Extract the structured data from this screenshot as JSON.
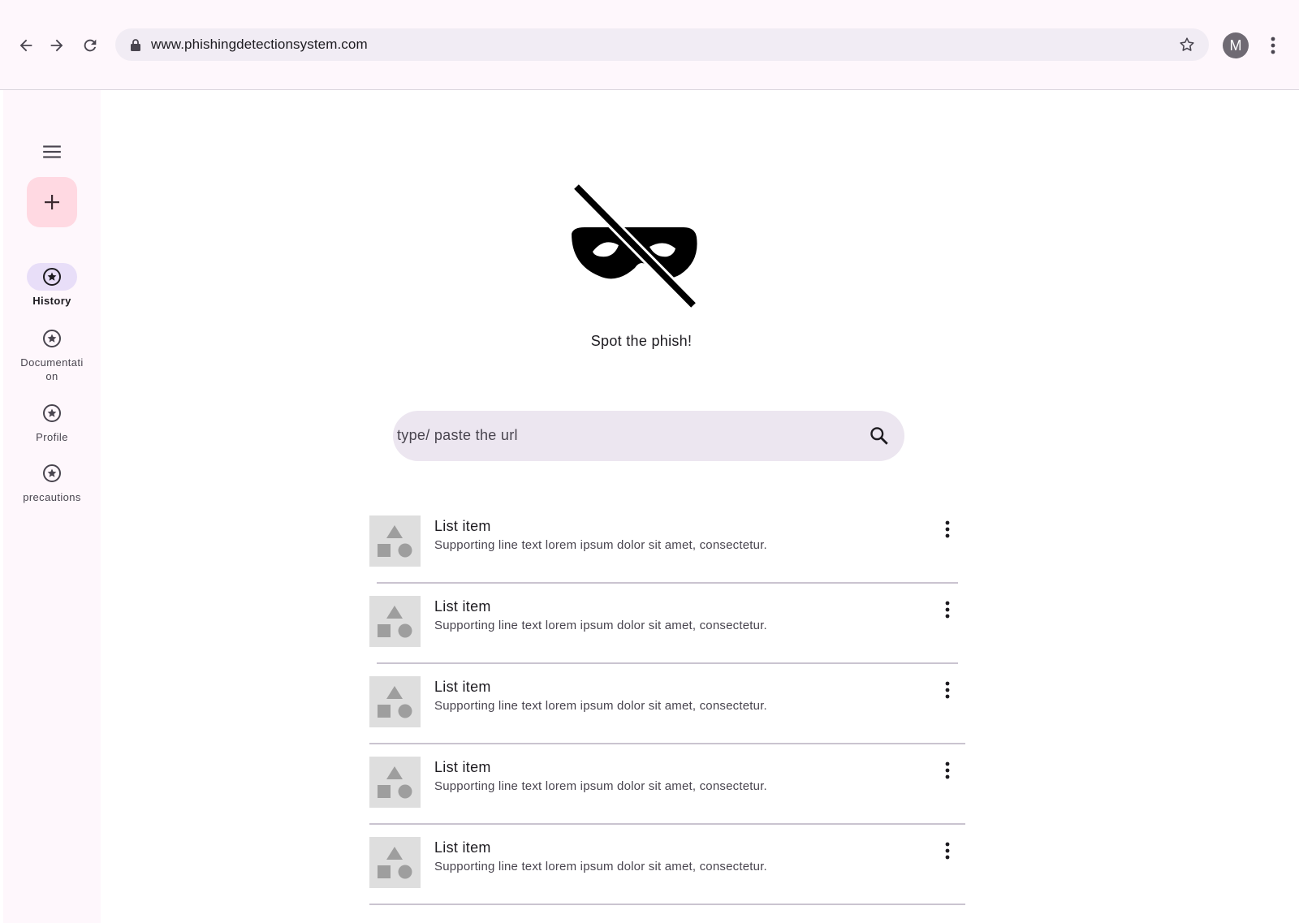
{
  "browser": {
    "url": "www.phishingdetectionsystem.com",
    "avatar_initial": "M"
  },
  "rail": {
    "items": [
      {
        "label": "History",
        "icon": "star-circle-icon",
        "active": true
      },
      {
        "label": "Documentation",
        "icon": "star-circle-icon",
        "active": false
      },
      {
        "label": "Profile",
        "icon": "star-circle-icon",
        "active": false
      },
      {
        "label": "precautions",
        "icon": "star-circle-icon",
        "active": false
      }
    ]
  },
  "main": {
    "hero_icon": "incognito-off-mask-icon",
    "tagline": "Spot the phish!",
    "search": {
      "placeholder": "type/ paste the url"
    },
    "list": [
      {
        "title": "List item",
        "supporting": "Supporting line text lorem ipsum dolor sit amet, consectetur."
      },
      {
        "title": "List item",
        "supporting": "Supporting line text lorem ipsum dolor sit amet, consectetur."
      },
      {
        "title": "List item",
        "supporting": "Supporting line text lorem ipsum dolor sit amet, consectetur."
      },
      {
        "title": "List item",
        "supporting": "Supporting line text lorem ipsum dolor sit amet, consectetur."
      },
      {
        "title": "List item",
        "supporting": "Supporting line text lorem ipsum dolor sit amet, consectetur."
      }
    ]
  },
  "colors": {
    "surface": "#fef7fc",
    "fab": "#ffd9e2",
    "active_indicator": "#e8def8",
    "search_bg": "#ece6f0"
  }
}
